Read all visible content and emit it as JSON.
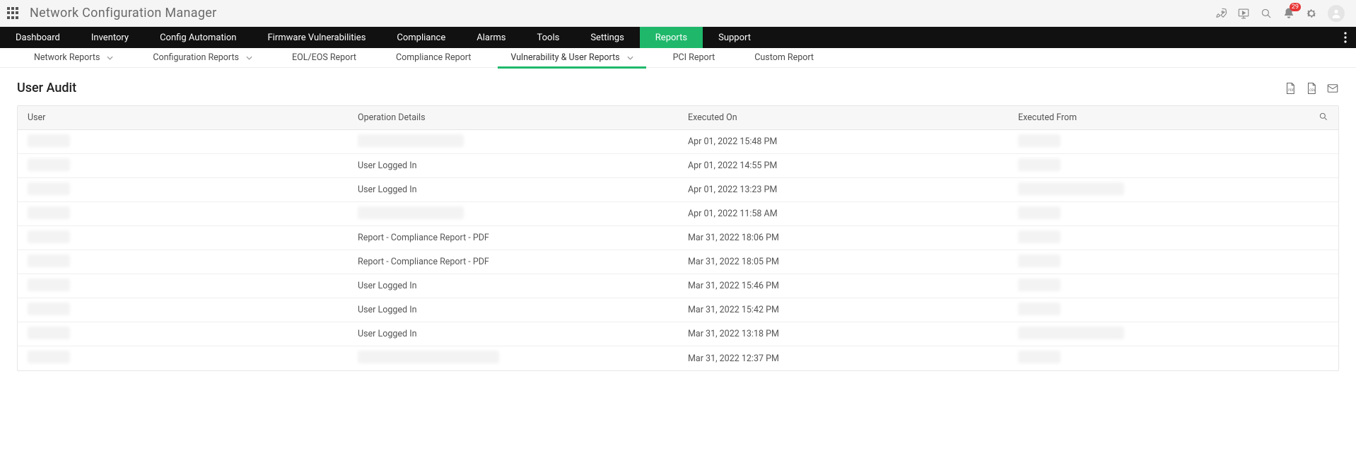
{
  "app": {
    "title": "Network Configuration Manager"
  },
  "header": {
    "notification_count": "29"
  },
  "main_nav": {
    "items": [
      {
        "label": "Dashboard"
      },
      {
        "label": "Inventory"
      },
      {
        "label": "Config Automation"
      },
      {
        "label": "Firmware Vulnerabilities"
      },
      {
        "label": "Compliance"
      },
      {
        "label": "Alarms"
      },
      {
        "label": "Tools"
      },
      {
        "label": "Settings"
      },
      {
        "label": "Reports",
        "active": true
      },
      {
        "label": "Support"
      }
    ]
  },
  "sub_nav": {
    "items": [
      {
        "label": "Network Reports",
        "dropdown": true
      },
      {
        "label": "Configuration Reports",
        "dropdown": true
      },
      {
        "label": "EOL/EOS Report"
      },
      {
        "label": "Compliance Report"
      },
      {
        "label": "Vulnerability & User Reports",
        "dropdown": true,
        "active": true
      },
      {
        "label": "PCI Report"
      },
      {
        "label": "Custom Report"
      }
    ]
  },
  "page": {
    "title": "User Audit"
  },
  "table": {
    "columns": {
      "user": "User",
      "op": "Operation Details",
      "exec": "Executed On",
      "from": "Executed From"
    },
    "rows": [
      {
        "user_hidden": true,
        "op_hidden": true,
        "exec": "Apr 01, 2022 15:48 PM",
        "from_hidden": true
      },
      {
        "user_hidden": true,
        "op": "User Logged In",
        "exec": "Apr 01, 2022 14:55 PM",
        "from_hidden": true
      },
      {
        "user_hidden": true,
        "op": "User Logged In",
        "exec": "Apr 01, 2022 13:23 PM",
        "from_hidden": true
      },
      {
        "user_hidden": true,
        "op_hidden": true,
        "exec": "Apr 01, 2022 11:58 AM",
        "from_hidden": true
      },
      {
        "user_hidden": true,
        "op": "Report - Compliance Report - PDF",
        "exec": "Mar 31, 2022 18:06 PM",
        "from_hidden": true
      },
      {
        "user_hidden": true,
        "op": "Report - Compliance Report - PDF",
        "exec": "Mar 31, 2022 18:05 PM",
        "from_hidden": true
      },
      {
        "user_hidden": true,
        "op": "User Logged In",
        "exec": "Mar 31, 2022 15:46 PM",
        "from_hidden": true
      },
      {
        "user_hidden": true,
        "op": "User Logged In",
        "exec": "Mar 31, 2022 15:42 PM",
        "from_hidden": true
      },
      {
        "user_hidden": true,
        "op": "User Logged In",
        "exec": "Mar 31, 2022 13:18 PM",
        "from_hidden": true
      },
      {
        "user_hidden": true,
        "op_hidden": true,
        "exec": "Mar 31, 2022 12:37 PM",
        "from_hidden": true
      }
    ]
  }
}
